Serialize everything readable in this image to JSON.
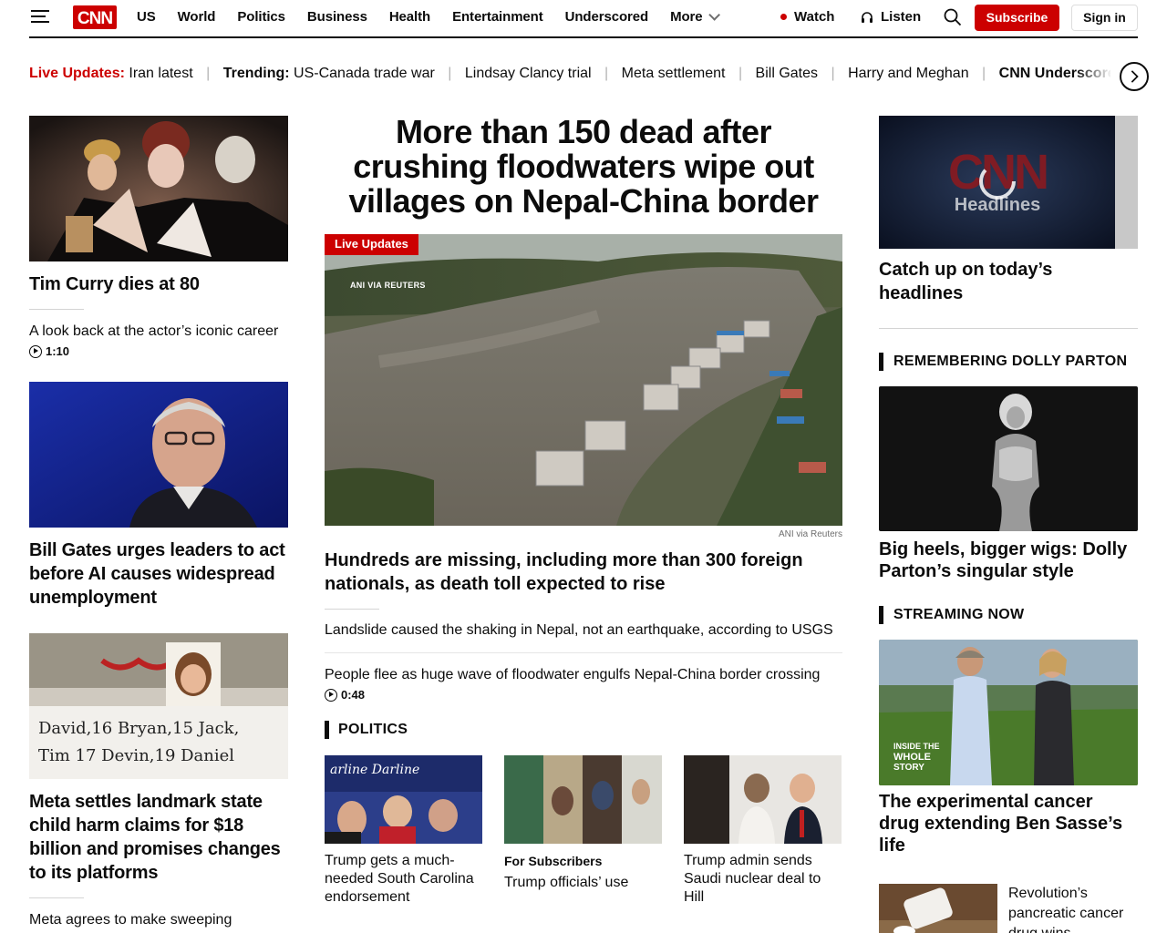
{
  "header": {
    "nav": [
      "US",
      "World",
      "Politics",
      "Business",
      "Health",
      "Entertainment",
      "Underscored"
    ],
    "more_label": "More",
    "watch_label": "Watch",
    "listen_label": "Listen",
    "subscribe_label": "Subscribe",
    "signin_label": "Sign in"
  },
  "ticker": {
    "live_label": "Live Updates:",
    "live_item": "Iran latest",
    "trending_label": "Trending:",
    "items": [
      "US-Canada trade war",
      "Lindsay Clancy trial",
      "Meta settlement",
      "Bill Gates",
      "Harry and Meghan"
    ],
    "last_item": "CNN Underscored:"
  },
  "left": {
    "card1": {
      "title": "Tim Curry dies at 80",
      "sub": "A look back at the actor’s iconic career",
      "duration": "1:10"
    },
    "card2": {
      "title": "Bill Gates urges leaders to act before AI causes widespread unemployment"
    },
    "card3": {
      "title": "Meta settles landmark state child harm claims for $18 billion and promises changes to its platforms",
      "sub": "Meta agrees to make sweeping"
    }
  },
  "center": {
    "hero_title": "More than 150 dead after crushing floodwaters wipe out villages on Nepal-China border",
    "badge": "Live Updates",
    "credit_overlay": "ANI VIA REUTERS",
    "credit": "ANI via Reuters",
    "hero_sub": "Hundreds are missing, including more than 300 foreign nationals, as death toll expected to rise",
    "related1": "Landslide caused the shaking in Nepal, not an earthquake, according to USGS",
    "related2": "People flee as huge wave of floodwater engulfs Nepal-China border crossing",
    "related2_duration": "0:48",
    "section": "POLITICS",
    "politics": [
      {
        "title": "Trump gets a much-needed South Carolina endorsement"
      },
      {
        "kicker": "For Subscribers",
        "title": "Trump officials’ use"
      },
      {
        "title": "Trump admin sends Saudi nuclear deal to Hill"
      }
    ]
  },
  "right": {
    "video_logo": "CNN",
    "video_sub": "Headlines",
    "video_title": "Catch up on today’s headlines",
    "section1": "REMEMBERING DOLLY PARTON",
    "dolly_title": "Big heels, bigger wigs: Dolly Parton’s singular style",
    "section2": "STREAMING NOW",
    "stream_badge": "INSIDE THE WHOLE STORY",
    "stream_title": "The experimental cancer drug extending Ben Sasse’s life",
    "small_title": "Revolution’s pancreatic cancer drug wins"
  },
  "colors": {
    "brand": "#cc0000",
    "text": "#0c0c0c",
    "muted": "#6e6e6e"
  }
}
